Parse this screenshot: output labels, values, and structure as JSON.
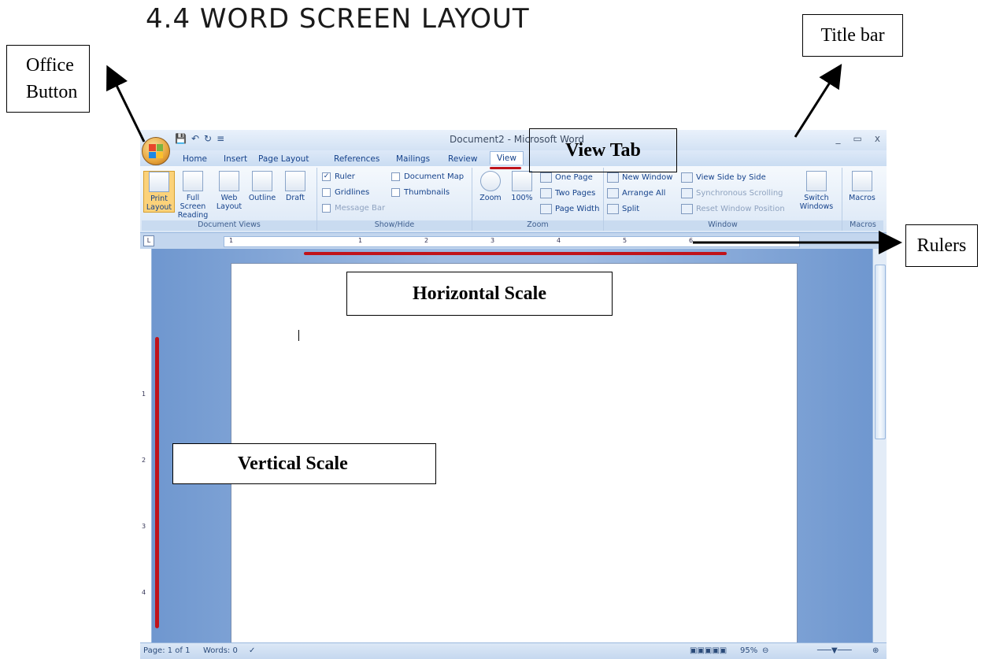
{
  "heading": "4.4 WORD SCREEN LAYOUT",
  "callouts": {
    "title_bar": "Title bar",
    "office_button_line1": "Office",
    "office_button_line2": "Button",
    "rulers": "Rulers",
    "view_tab": "View Tab",
    "horizontal_scale": "Horizontal Scale",
    "vertical_scale": "Vertical Scale"
  },
  "window": {
    "title": "Document2 - Microsoft Word",
    "controls": [
      "_",
      "▭",
      "x"
    ],
    "tabs": [
      "Home",
      "Insert",
      "Page Layout",
      "References",
      "Mailings",
      "Review",
      "View"
    ],
    "active_tab": "View",
    "groups": {
      "document_views": {
        "label": "Document Views",
        "buttons": [
          "Print Layout",
          "Full Screen Reading",
          "Web Layout",
          "Outline",
          "Draft"
        ]
      },
      "show_hide": {
        "label": "Show/Hide",
        "ruler": "Ruler",
        "ruler_checked": true,
        "gridlines": "Gridlines",
        "message_bar": "Message Bar",
        "document_map": "Document Map",
        "thumbnails": "Thumbnails"
      },
      "zoom": {
        "label": "Zoom",
        "zoom": "Zoom",
        "percent": "100%",
        "one_page": "One Page",
        "two_pages": "Two Pages",
        "page_width": "Page Width"
      },
      "window": {
        "label": "Window",
        "new_window": "New Window",
        "arrange_all": "Arrange All",
        "split": "Split",
        "view_side_by_side": "View Side by Side",
        "sync_scrolling": "Synchronous Scrolling",
        "reset_position": "Reset Window Position",
        "switch_windows": "Switch Windows"
      },
      "macros": {
        "label": "Macros",
        "macros": "Macros"
      }
    },
    "ruler_numbers": [
      "1",
      "1",
      "2",
      "3",
      "4",
      "5",
      "6"
    ],
    "vruler_numbers": [
      "1",
      "2",
      "3",
      "4"
    ],
    "status": {
      "page": "Page: 1 of 1",
      "words": "Words: 0",
      "zoom": "95%"
    }
  }
}
